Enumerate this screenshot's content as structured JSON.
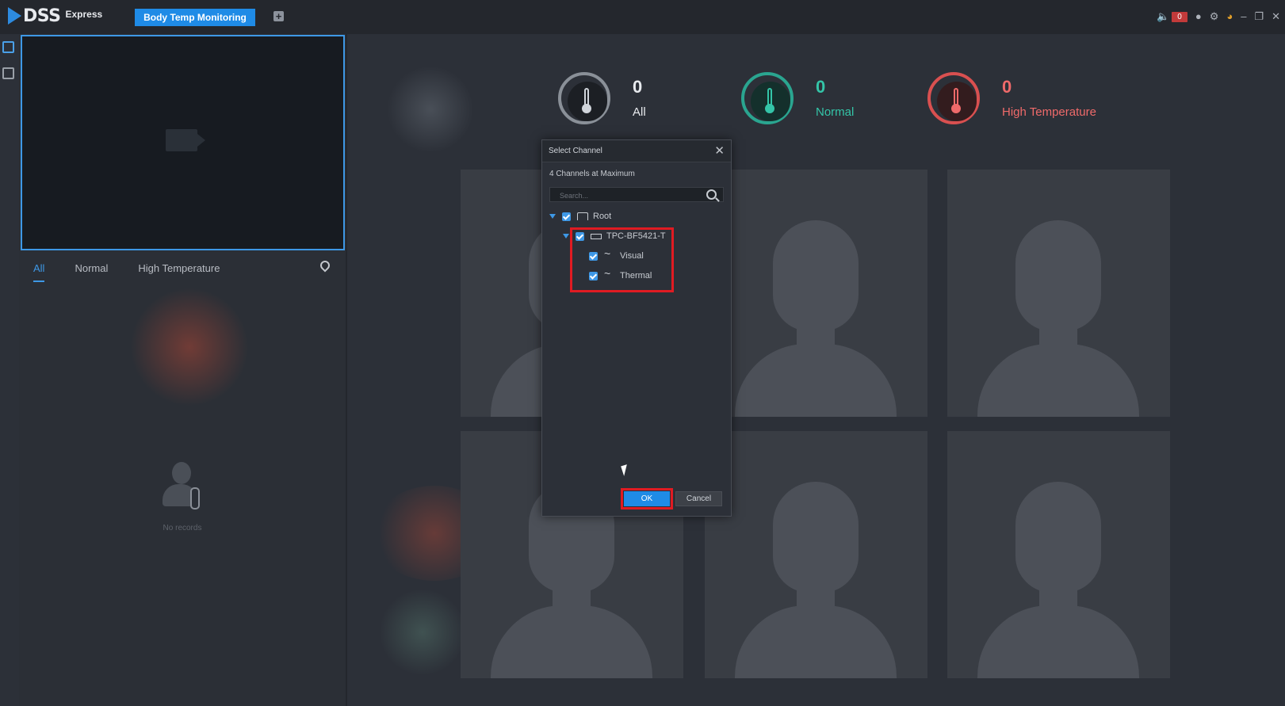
{
  "titlebar": {
    "logo_text": "DSS",
    "logo_sub": "Express",
    "active_tab": "Body Temp Monitoring",
    "add_tab": "+",
    "alarm_count": "0"
  },
  "left": {
    "tabs": [
      "All",
      "Normal",
      "High Temperature"
    ],
    "no_records": "No records"
  },
  "stats": [
    {
      "value": "0",
      "label": "All",
      "color": "#e8eaee",
      "ring": "#8a9098"
    },
    {
      "value": "0",
      "label": "Normal",
      "color": "#34c5a8",
      "ring": "#2aa590"
    },
    {
      "value": "0",
      "label": "High Temperature",
      "color": "#ef6a6a",
      "ring": "#d95050"
    }
  ],
  "dialog": {
    "title": "Select Channel",
    "hint": "4 Channels at Maximum",
    "search_placeholder": "Search...",
    "tree": {
      "root": "Root",
      "device": "TPC-BF5421-T",
      "channels": [
        "Visual",
        "Thermal"
      ]
    },
    "ok": "OK",
    "cancel": "Cancel"
  }
}
